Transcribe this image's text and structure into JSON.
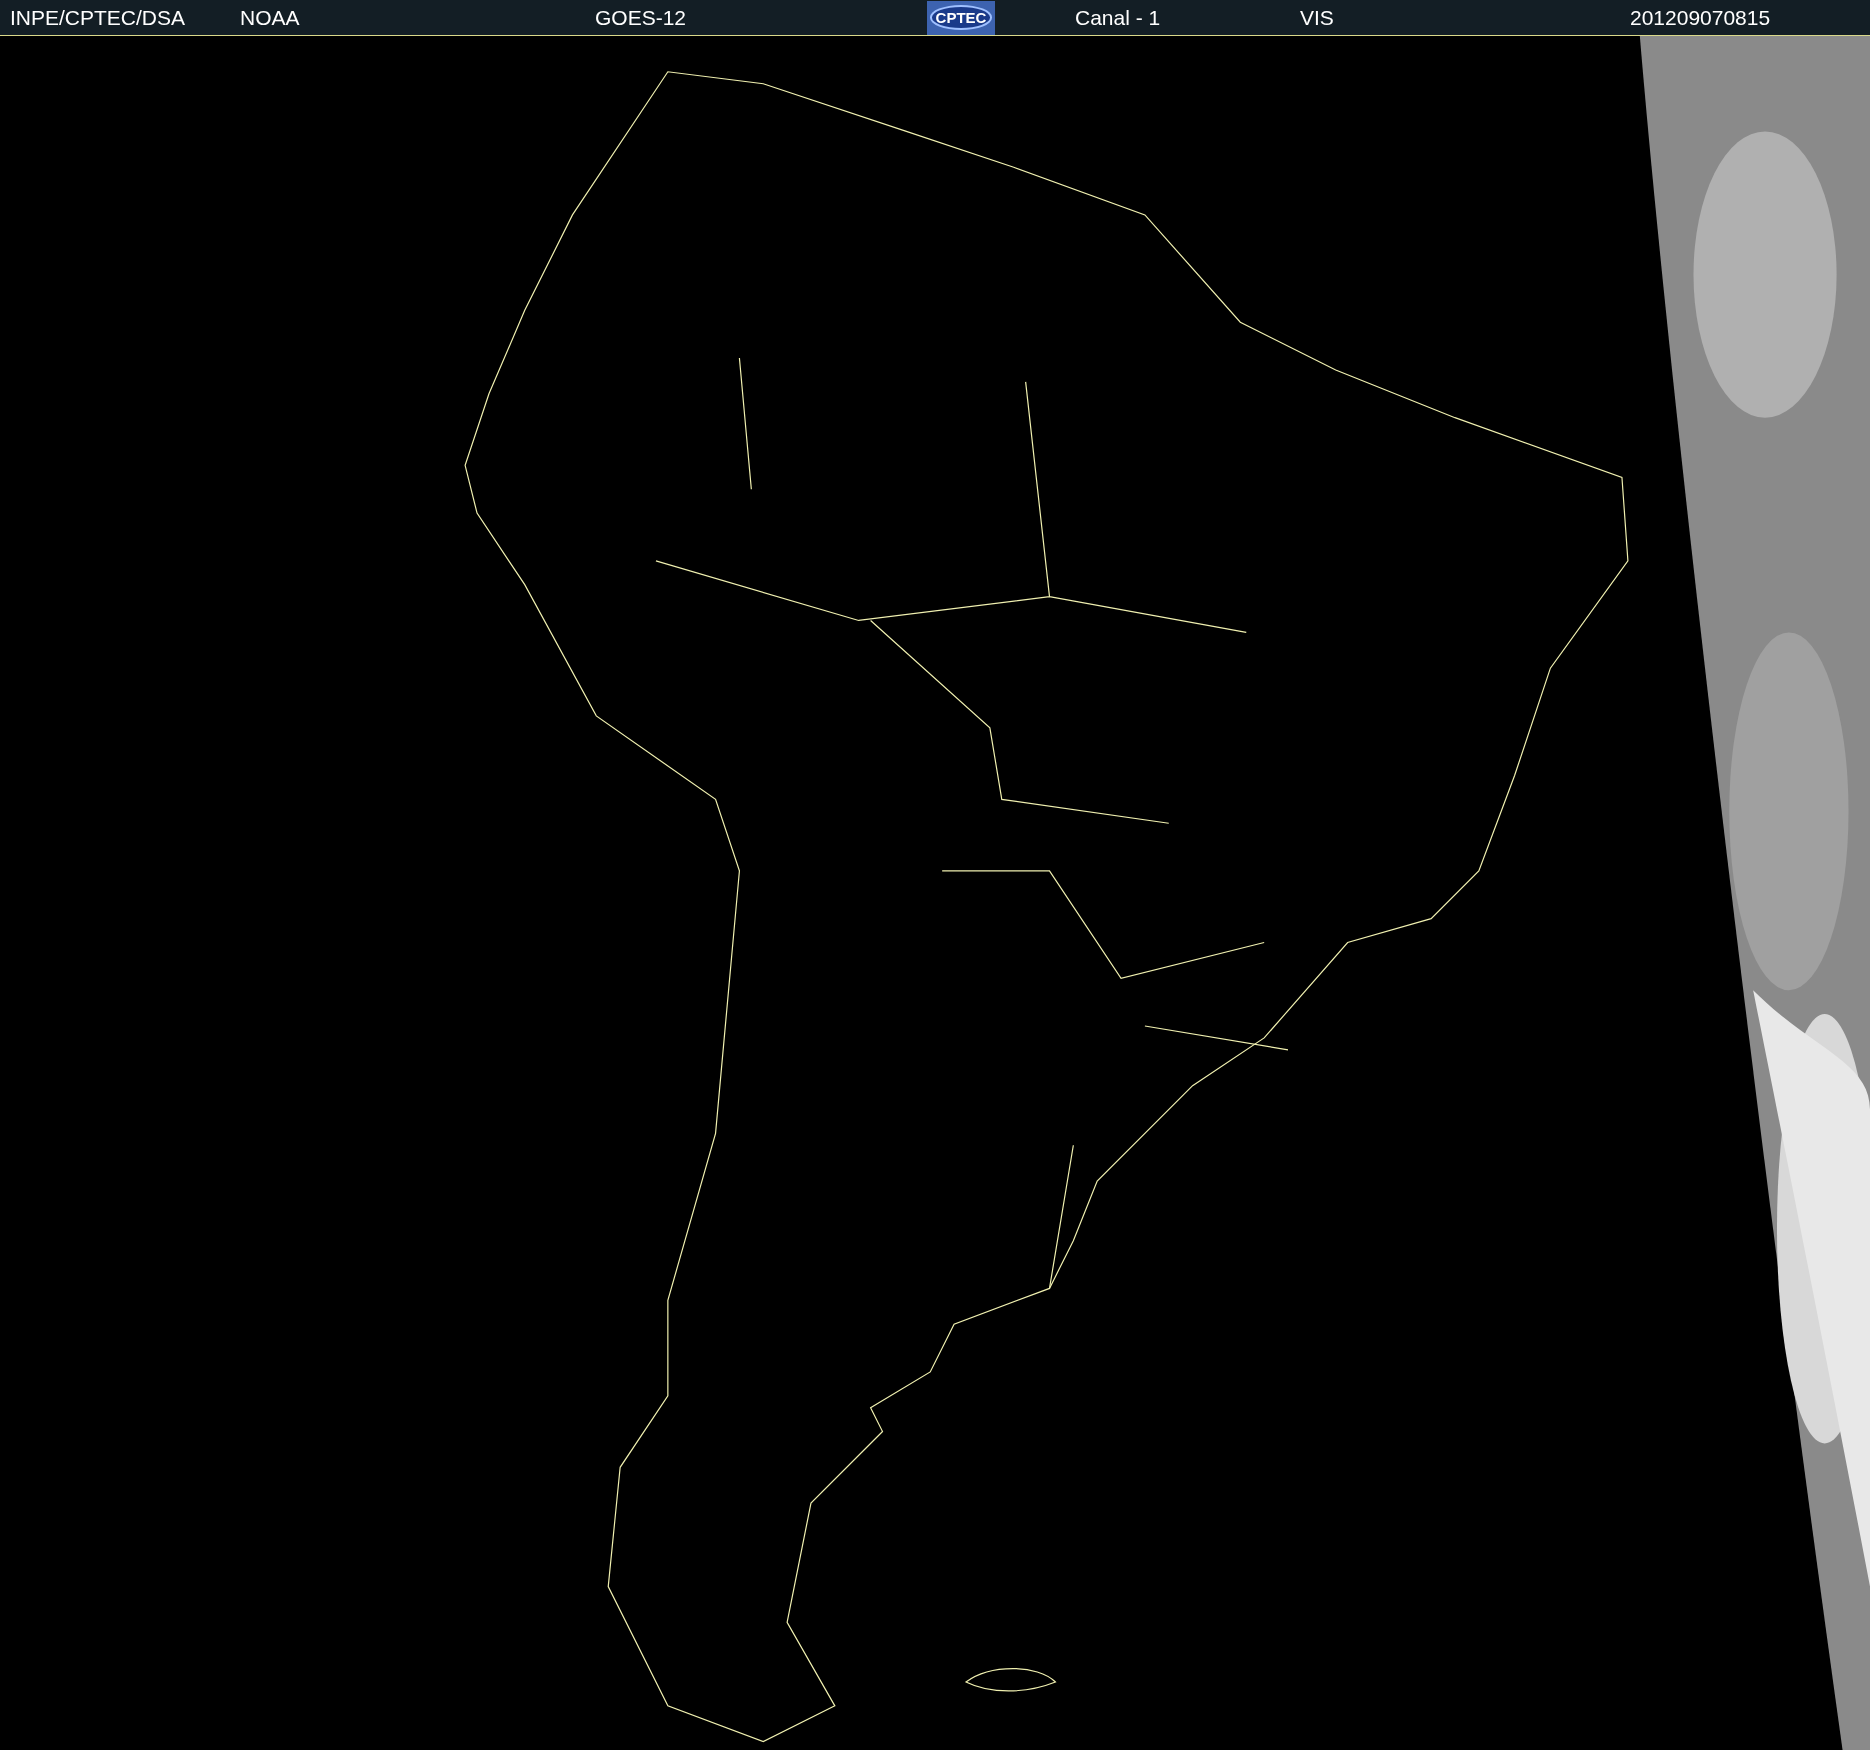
{
  "header": {
    "items": [
      {
        "kind": "text",
        "text": "INPE/CPTEC/DSA"
      },
      {
        "kind": "text",
        "text": "NOAA"
      },
      {
        "kind": "text",
        "text": "GOES-12"
      },
      {
        "kind": "logo",
        "text": "CPTEC"
      },
      {
        "kind": "text",
        "text": "Canal - 1"
      },
      {
        "kind": "text",
        "text": "VIS"
      },
      {
        "kind": "text",
        "text": "201209070815"
      }
    ]
  }
}
